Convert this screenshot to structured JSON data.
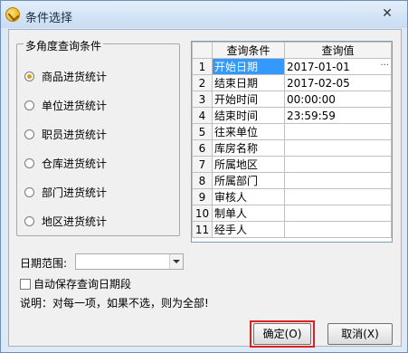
{
  "window": {
    "title": "条件选择",
    "close_glyph": "✕"
  },
  "group": {
    "title": "多角度查询条件",
    "options": [
      {
        "label": "商品进货统计",
        "selected": true
      },
      {
        "label": "单位进货统计",
        "selected": false
      },
      {
        "label": "职员进货统计",
        "selected": false
      },
      {
        "label": "仓库进货统计",
        "selected": false
      },
      {
        "label": "部门进货统计",
        "selected": false
      },
      {
        "label": "地区进货统计",
        "selected": false
      }
    ]
  },
  "grid": {
    "headers": [
      "",
      "查询条件",
      "查询值"
    ],
    "rows": [
      {
        "no": "1",
        "cond": "开始日期",
        "value": "2017-01-01"
      },
      {
        "no": "2",
        "cond": "结束日期",
        "value": "2017-02-05"
      },
      {
        "no": "3",
        "cond": "开始时间",
        "value": "00:00:00"
      },
      {
        "no": "4",
        "cond": "结束时间",
        "value": "23:59:59"
      },
      {
        "no": "5",
        "cond": "往来单位",
        "value": ""
      },
      {
        "no": "6",
        "cond": "库房名称",
        "value": ""
      },
      {
        "no": "7",
        "cond": "所属地区",
        "value": ""
      },
      {
        "no": "8",
        "cond": "所属部门",
        "value": ""
      },
      {
        "no": "9",
        "cond": "审核人",
        "value": ""
      },
      {
        "no": "10",
        "cond": "制单人",
        "value": ""
      },
      {
        "no": "11",
        "cond": "经手人",
        "value": ""
      }
    ],
    "ellipsis": "···"
  },
  "date_range": {
    "label": "日期范围:",
    "value": ""
  },
  "autosave": {
    "label": "自动保存查询日期段",
    "checked": false
  },
  "note": "说明：对每一项，如果不选，则为全部!",
  "buttons": {
    "ok": "确定(O)",
    "cancel": "取消(X)"
  }
}
